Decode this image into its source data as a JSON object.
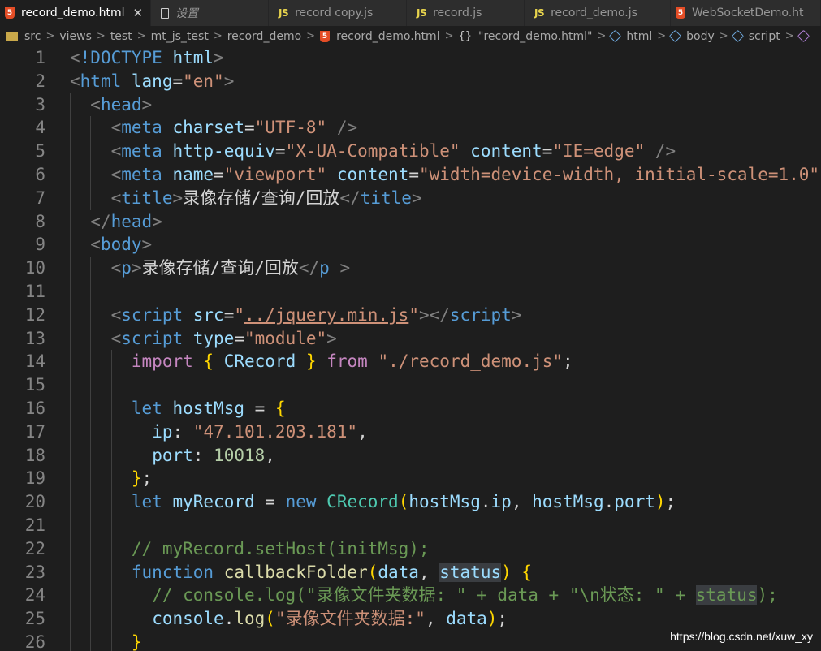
{
  "tabs": [
    {
      "label": "record_demo.html",
      "icon": "html5-icon",
      "active": true,
      "close": "✕"
    },
    {
      "label": "设置",
      "icon": "file-icon",
      "active": false
    },
    {
      "label": "record copy.js",
      "icon": "js-icon",
      "active": false
    },
    {
      "label": "record.js",
      "icon": "js-icon",
      "active": false
    },
    {
      "label": "record_demo.js",
      "icon": "js-icon",
      "active": false
    },
    {
      "label": "WebSocketDemo.ht",
      "icon": "html5-icon",
      "active": false
    }
  ],
  "icon_labels": {
    "html": "5",
    "js": "JS"
  },
  "breadcrumb": {
    "items": [
      "src",
      "views",
      "test",
      "mt_js_test",
      "record_demo",
      "record_demo.html",
      "\"record_demo.html\"",
      "html",
      "body",
      "script"
    ],
    "separator": ">",
    "braces": "{}"
  },
  "colors": {
    "background": "#1e1e1e",
    "tab_bar": "#252526",
    "keyword": "#569cd6",
    "string": "#ce9178",
    "attribute": "#9cdcfe",
    "comment": "#6a9955",
    "function": "#dcdcaa",
    "control": "#c586c0",
    "class": "#4ec9b0",
    "number": "#b5cea8"
  },
  "editor": {
    "lines": [
      {
        "n": "1",
        "indent": 0,
        "tokens": [
          [
            "p",
            "<"
          ],
          [
            "tag",
            "!DOCTYPE"
          ],
          [
            "tx",
            " "
          ],
          [
            "at",
            "html"
          ],
          [
            "p",
            ">"
          ]
        ]
      },
      {
        "n": "2",
        "indent": 0,
        "tokens": [
          [
            "p",
            "<"
          ],
          [
            "tag",
            "html"
          ],
          [
            "tx",
            " "
          ],
          [
            "at",
            "lang"
          ],
          [
            "tx",
            "="
          ],
          [
            "s",
            "\"en\""
          ],
          [
            "p",
            ">"
          ]
        ]
      },
      {
        "n": "3",
        "indent": 1,
        "tokens": [
          [
            "p",
            "<"
          ],
          [
            "tag",
            "head"
          ],
          [
            "p",
            ">"
          ]
        ]
      },
      {
        "n": "4",
        "indent": 2,
        "tokens": [
          [
            "p",
            "<"
          ],
          [
            "tag",
            "meta"
          ],
          [
            "tx",
            " "
          ],
          [
            "at",
            "charset"
          ],
          [
            "tx",
            "="
          ],
          [
            "s",
            "\"UTF-8\""
          ],
          [
            "tx",
            " "
          ],
          [
            "p",
            "/>"
          ]
        ]
      },
      {
        "n": "5",
        "indent": 2,
        "tokens": [
          [
            "p",
            "<"
          ],
          [
            "tag",
            "meta"
          ],
          [
            "tx",
            " "
          ],
          [
            "at",
            "http-equiv"
          ],
          [
            "tx",
            "="
          ],
          [
            "s",
            "\"X-UA-Compatible\""
          ],
          [
            "tx",
            " "
          ],
          [
            "at",
            "content"
          ],
          [
            "tx",
            "="
          ],
          [
            "s",
            "\"IE=edge\""
          ],
          [
            "tx",
            " "
          ],
          [
            "p",
            "/>"
          ]
        ]
      },
      {
        "n": "6",
        "indent": 2,
        "tokens": [
          [
            "p",
            "<"
          ],
          [
            "tag",
            "meta"
          ],
          [
            "tx",
            " "
          ],
          [
            "at",
            "name"
          ],
          [
            "tx",
            "="
          ],
          [
            "s",
            "\"viewport\""
          ],
          [
            "tx",
            " "
          ],
          [
            "at",
            "content"
          ],
          [
            "tx",
            "="
          ],
          [
            "s",
            "\"width=device-width, initial-scale=1.0\""
          ]
        ]
      },
      {
        "n": "7",
        "indent": 2,
        "tokens": [
          [
            "p",
            "<"
          ],
          [
            "tag",
            "title"
          ],
          [
            "p",
            ">"
          ],
          [
            "tx",
            "录像存储/查询/回放"
          ],
          [
            "p",
            "</"
          ],
          [
            "tag",
            "title"
          ],
          [
            "p",
            ">"
          ]
        ]
      },
      {
        "n": "8",
        "indent": 1,
        "tokens": [
          [
            "p",
            "</"
          ],
          [
            "tag",
            "head"
          ],
          [
            "p",
            ">"
          ]
        ]
      },
      {
        "n": "9",
        "indent": 1,
        "tokens": [
          [
            "p",
            "<"
          ],
          [
            "tag",
            "body"
          ],
          [
            "p",
            ">"
          ]
        ]
      },
      {
        "n": "10",
        "indent": 2,
        "tokens": [
          [
            "p",
            "<"
          ],
          [
            "tag",
            "p"
          ],
          [
            "p",
            ">"
          ],
          [
            "tx",
            "录像存储/查询/回放"
          ],
          [
            "p",
            "</"
          ],
          [
            "tag",
            "p"
          ],
          [
            "tx",
            " "
          ],
          [
            "p",
            ">"
          ]
        ]
      },
      {
        "n": "11",
        "indent": 0,
        "tokens": []
      },
      {
        "n": "12",
        "indent": 2,
        "tokens": [
          [
            "p",
            "<"
          ],
          [
            "tag",
            "script"
          ],
          [
            "tx",
            " "
          ],
          [
            "at",
            "src"
          ],
          [
            "tx",
            "="
          ],
          [
            "s",
            "\""
          ],
          [
            "link",
            "../jquery.min.js"
          ],
          [
            "s",
            "\""
          ],
          [
            "p",
            "></"
          ],
          [
            "tag",
            "script"
          ],
          [
            "p",
            ">"
          ]
        ]
      },
      {
        "n": "13",
        "indent": 2,
        "tokens": [
          [
            "p",
            "<"
          ],
          [
            "tag",
            "script"
          ],
          [
            "tx",
            " "
          ],
          [
            "at",
            "type"
          ],
          [
            "tx",
            "="
          ],
          [
            "s",
            "\"module\""
          ],
          [
            "p",
            ">"
          ]
        ]
      },
      {
        "n": "14",
        "indent": 3,
        "tokens": [
          [
            "ck",
            "import"
          ],
          [
            "tx",
            " "
          ],
          [
            "br",
            "{"
          ],
          [
            "tx",
            " "
          ],
          [
            "var",
            "CRecord"
          ],
          [
            "tx",
            " "
          ],
          [
            "br",
            "}"
          ],
          [
            "tx",
            " "
          ],
          [
            "ck",
            "from"
          ],
          [
            "tx",
            " "
          ],
          [
            "s",
            "\"./record_demo.js\""
          ],
          [
            "tx",
            ";"
          ]
        ]
      },
      {
        "n": "15",
        "indent": 0,
        "tokens": []
      },
      {
        "n": "16",
        "indent": 3,
        "tokens": [
          [
            "kw",
            "let"
          ],
          [
            "tx",
            " "
          ],
          [
            "var",
            "hostMsg"
          ],
          [
            "tx",
            " = "
          ],
          [
            "br",
            "{"
          ]
        ]
      },
      {
        "n": "17",
        "indent": 4,
        "tokens": [
          [
            "var",
            "ip"
          ],
          [
            "tx",
            ": "
          ],
          [
            "s",
            "\"47.101.203.181\""
          ],
          [
            "tx",
            ","
          ]
        ]
      },
      {
        "n": "18",
        "indent": 4,
        "tokens": [
          [
            "var",
            "port"
          ],
          [
            "tx",
            ": "
          ],
          [
            "num",
            "10018"
          ],
          [
            "tx",
            ","
          ]
        ]
      },
      {
        "n": "19",
        "indent": 3,
        "tokens": [
          [
            "br",
            "}"
          ],
          [
            "tx",
            ";"
          ]
        ]
      },
      {
        "n": "20",
        "indent": 3,
        "tokens": [
          [
            "kw",
            "let"
          ],
          [
            "tx",
            " "
          ],
          [
            "var",
            "myRecord"
          ],
          [
            "tx",
            " = "
          ],
          [
            "kw",
            "new"
          ],
          [
            "tx",
            " "
          ],
          [
            "cls",
            "CRecord"
          ],
          [
            "br",
            "("
          ],
          [
            "var",
            "hostMsg"
          ],
          [
            "tx",
            "."
          ],
          [
            "var",
            "ip"
          ],
          [
            "tx",
            ", "
          ],
          [
            "var",
            "hostMsg"
          ],
          [
            "tx",
            "."
          ],
          [
            "var",
            "port"
          ],
          [
            "br",
            ")"
          ],
          [
            "tx",
            ";"
          ]
        ]
      },
      {
        "n": "21",
        "indent": 0,
        "tokens": []
      },
      {
        "n": "22",
        "indent": 3,
        "tokens": [
          [
            "cm",
            "// myRecord.setHost(initMsg);"
          ]
        ]
      },
      {
        "n": "23",
        "indent": 3,
        "tokens": [
          [
            "kw",
            "function"
          ],
          [
            "tx",
            " "
          ],
          [
            "fn",
            "callbackFolder"
          ],
          [
            "br",
            "("
          ],
          [
            "var",
            "data"
          ],
          [
            "tx",
            ", "
          ],
          [
            "varhl",
            "status"
          ],
          [
            "br",
            ")"
          ],
          [
            "tx",
            " "
          ],
          [
            "br",
            "{"
          ]
        ]
      },
      {
        "n": "24",
        "indent": 4,
        "tokens": [
          [
            "cm",
            "// console.log(\"录像文件夹数据: \" + data + \"\\n状态: \" + "
          ],
          [
            "cmhl",
            "status"
          ],
          [
            "cm",
            ");"
          ]
        ]
      },
      {
        "n": "25",
        "indent": 4,
        "tokens": [
          [
            "var",
            "console"
          ],
          [
            "tx",
            "."
          ],
          [
            "fn",
            "log"
          ],
          [
            "br",
            "("
          ],
          [
            "s",
            "\"录像文件夹数据:\""
          ],
          [
            "tx",
            ", "
          ],
          [
            "var",
            "data"
          ],
          [
            "br",
            ")"
          ],
          [
            "tx",
            ";"
          ]
        ]
      },
      {
        "n": "26",
        "indent": 3,
        "tokens": [
          [
            "br",
            "}"
          ]
        ]
      }
    ]
  },
  "watermark": "https://blog.csdn.net/xuw_xy"
}
